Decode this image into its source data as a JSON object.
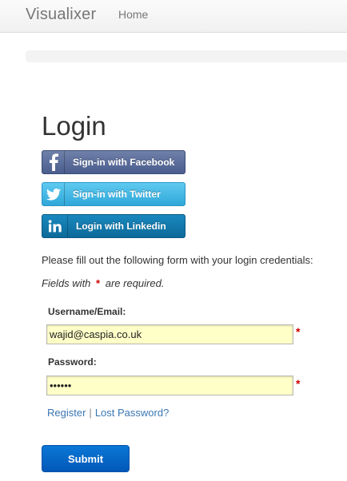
{
  "navbar": {
    "brand": "Visualixer",
    "home_label": "Home"
  },
  "page": {
    "title": "Login"
  },
  "social": {
    "facebook_label": "Sign-in with Facebook",
    "twitter_label": "Sign-in with Twitter",
    "linkedin_label": "Login with Linkedin",
    "facebook_icon": "facebook-icon",
    "twitter_icon": "twitter-bird-icon",
    "linkedin_icon": "linkedin-icon"
  },
  "form": {
    "intro": "Please fill out the following form with your login credentials:",
    "required_prefix": "Fields with",
    "required_star": "*",
    "required_suffix": "are required.",
    "username_label": "Username/Email:",
    "username_value": "wajid@caspia.co.uk",
    "password_label": "Password:",
    "password_value": "••••••",
    "required_marker": "*",
    "register_link": "Register",
    "link_separator": "|",
    "lost_password_link": "Lost Password?",
    "submit_label": "Submit"
  },
  "colors": {
    "facebook": "#4a5d8e",
    "twitter": "#2fa7d9",
    "linkedin": "#0c6a9a",
    "input_background": "#ffffc8",
    "required": "#cc0000",
    "link": "#3a77b5",
    "submit": "#0258b8"
  }
}
